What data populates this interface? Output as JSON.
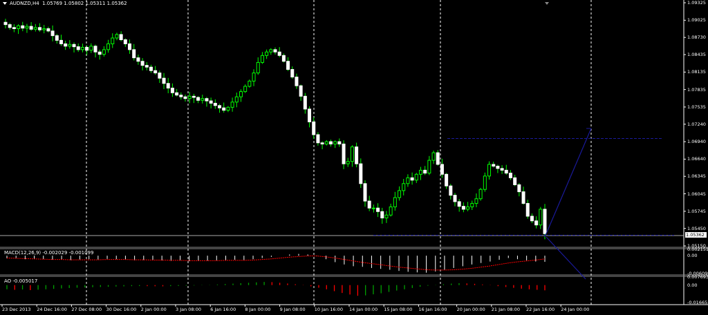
{
  "header": {
    "symbol": "AUDNZD,H4",
    "ohlc": "1.05769 1.05802 1.05311 1.05362"
  },
  "price_tag": "1.05362",
  "indicators": {
    "macd_label": "MACD(12,26,9) -0.002029 -0.001099",
    "ao_label": "AO -0.005017"
  },
  "colors": {
    "background": "#000000",
    "bull_candle": "#00ff00",
    "bear_candle": "#ffffff",
    "grid": "#ffffff",
    "trendline": "#1a1a9a",
    "macd_signal": "#ff0000",
    "ao_up": "#00a000",
    "ao_down": "#ff0000"
  },
  "chart_data": [
    {
      "type": "candlestick",
      "title": "AUDNZD,H4",
      "y_ticks": [
        "1.09325",
        "1.09025",
        "1.08730",
        "1.08435",
        "1.08135",
        "1.07835",
        "1.07535",
        "1.07240",
        "1.06940",
        "1.06640",
        "1.06345",
        "1.06045",
        "1.05745",
        "1.05450",
        "1.05150"
      ],
      "ylim": [
        1.0515,
        1.09325
      ],
      "x_ticks": [
        "23 Dec 2013",
        "24 Dec 16:00",
        "27 Dec 08:00",
        "30 Dec 16:00",
        "2 Jan 00:00",
        "3 Jan 08:00",
        "6 Jan 16:00",
        "8 Jan 00:00",
        "9 Jan 08:00",
        "10 Jan 16:00",
        "14 Jan 00:00",
        "15 Jan 08:00",
        "16 Jan 16:00",
        "20 Jan 00:00",
        "21 Jan 08:00",
        "22 Jan 16:00",
        "24 Jan 00:00"
      ],
      "close_path": [
        1.0895,
        1.089,
        1.0888,
        1.0893,
        1.0889,
        1.0892,
        1.0887,
        1.089,
        1.0886,
        1.0888,
        1.0884,
        1.0876,
        1.0868,
        1.0862,
        1.0858,
        1.0861,
        1.0857,
        1.0852,
        1.0856,
        1.0851,
        1.0858,
        1.0848,
        1.0844,
        1.0852,
        1.0862,
        1.0872,
        1.0878,
        1.0869,
        1.0862,
        1.0852,
        1.0838,
        1.0832,
        1.0825,
        1.0822,
        1.0816,
        1.0812,
        1.0803,
        1.0794,
        1.0786,
        1.0778,
        1.0774,
        1.0771,
        1.0768,
        1.0772,
        1.077,
        1.0765,
        1.0768,
        1.0764,
        1.076,
        1.0756,
        1.0752,
        1.0748,
        1.0753,
        1.0762,
        1.0771,
        1.078,
        1.0789,
        1.0798,
        1.0812,
        1.083,
        1.0842,
        1.0848,
        1.0852,
        1.0848,
        1.0842,
        1.0832,
        1.0818,
        1.0805,
        1.079,
        1.0772,
        1.075,
        1.0728,
        1.0706,
        1.0692,
        1.069,
        1.0694,
        1.069,
        1.0694,
        1.069,
        1.0656,
        1.066,
        1.0685,
        1.0656,
        1.0622,
        1.0592,
        1.058,
        1.058,
        1.0574,
        1.0563,
        1.0568,
        1.0582,
        1.0598,
        1.061,
        1.0622,
        1.0632,
        1.0628,
        1.0638,
        1.0645,
        1.064,
        1.0662,
        1.0675,
        1.0655,
        1.0638,
        1.0618,
        1.0602,
        1.0591,
        1.0583,
        1.0578,
        1.0582,
        1.0588,
        1.0596,
        1.0612,
        1.0635,
        1.0655,
        1.0652,
        1.0648,
        1.0645,
        1.064,
        1.0632,
        1.062,
        1.0608,
        1.0588,
        1.0566,
        1.0558,
        1.0551,
        1.0578,
        1.0536
      ],
      "resistance_level": 1.06995,
      "support_level": 1.0537
    },
    {
      "type": "bar",
      "title": "MACD(12,26,9)",
      "y_ticks": [
        "0.002151",
        "0.00",
        "-0.006099"
      ],
      "ylim": [
        -0.006099,
        0.002151
      ],
      "values": [
        -0.0009,
        -0.001,
        -0.0012,
        -0.0011,
        -0.0012,
        -0.0014,
        -0.0013,
        -0.0015,
        -0.0013,
        -0.0012,
        -0.0013,
        -0.0011,
        -0.0012,
        -0.0014,
        -0.0016,
        -0.0015,
        -0.0015,
        -0.0016,
        -0.0018,
        -0.0017,
        -0.0019,
        -0.0018,
        -0.0017,
        -0.0016,
        -0.0015,
        -0.0014,
        -0.0016,
        -0.0012,
        -0.0008,
        -0.0004,
        0.0,
        0.0004,
        0.0006,
        0.0004,
        -0.0002,
        -0.0012,
        -0.0022,
        -0.003,
        -0.0036,
        -0.0038,
        -0.0042,
        -0.0045,
        -0.0048,
        -0.0052,
        -0.0055,
        -0.0057,
        -0.0058,
        -0.0054,
        -0.0048,
        -0.0042,
        -0.0036,
        -0.003,
        -0.0025,
        -0.002,
        -0.0014,
        -0.0008,
        -0.0012,
        -0.0016,
        -0.002,
        -0.0021
      ],
      "signal": [
        -0.0008,
        -0.0009,
        -0.001,
        -0.0011,
        -0.0012,
        -0.0013,
        -0.0013,
        -0.0014,
        -0.0014,
        -0.0014,
        -0.0014,
        -0.0013,
        -0.0013,
        -0.0013,
        -0.0014,
        -0.0014,
        -0.0015,
        -0.0015,
        -0.0016,
        -0.0016,
        -0.0017,
        -0.0017,
        -0.0017,
        -0.0017,
        -0.0016,
        -0.0016,
        -0.0016,
        -0.0015,
        -0.0013,
        -0.0011,
        -0.0008,
        -0.0005,
        -0.0003,
        -0.0001,
        -0.0001,
        -0.0004,
        -0.0008,
        -0.0013,
        -0.0018,
        -0.0023,
        -0.0027,
        -0.0031,
        -0.0035,
        -0.0039,
        -0.0042,
        -0.0045,
        -0.0048,
        -0.0049,
        -0.0049,
        -0.0048,
        -0.0046,
        -0.0043,
        -0.0039,
        -0.0035,
        -0.003,
        -0.0025,
        -0.0021,
        -0.0018,
        -0.0015,
        -0.0011
      ]
    },
    {
      "type": "bar",
      "title": "AO",
      "y_ticks": [
        "0.007693",
        "0.00",
        "-0.016655"
      ],
      "ylim": [
        -0.016655,
        0.007693
      ],
      "values": [
        -0.004,
        -0.0045,
        -0.0042,
        -0.0048,
        -0.0044,
        -0.004,
        -0.0036,
        -0.0032,
        -0.0028,
        -0.0025,
        -0.0022,
        -0.002,
        -0.0018,
        -0.0016,
        -0.0014,
        -0.0012,
        -0.001,
        -0.0009,
        -0.001,
        -0.0011,
        -0.0012,
        -0.001,
        -0.0008,
        -0.0006,
        -0.0004,
        -0.0002,
        0.0002,
        0.0006,
        0.001,
        0.0014,
        0.0018,
        0.0022,
        0.0026,
        0.003,
        0.0028,
        0.0022,
        0.0015,
        0.0008,
        -0.0002,
        -0.0012,
        -0.0025,
        -0.004,
        -0.0058,
        -0.0075,
        -0.009,
        -0.0102,
        -0.0098,
        -0.0088,
        -0.0078,
        -0.0065,
        -0.0052,
        -0.004,
        -0.0028,
        -0.0016,
        -0.0006,
        0.0002,
        0.0008,
        0.0014,
        0.0018,
        0.0016,
        0.0012,
        0.0006,
        -0.0002,
        -0.001,
        -0.0018,
        -0.0026,
        -0.0034,
        -0.004,
        -0.0045,
        -0.005
      ]
    }
  ]
}
